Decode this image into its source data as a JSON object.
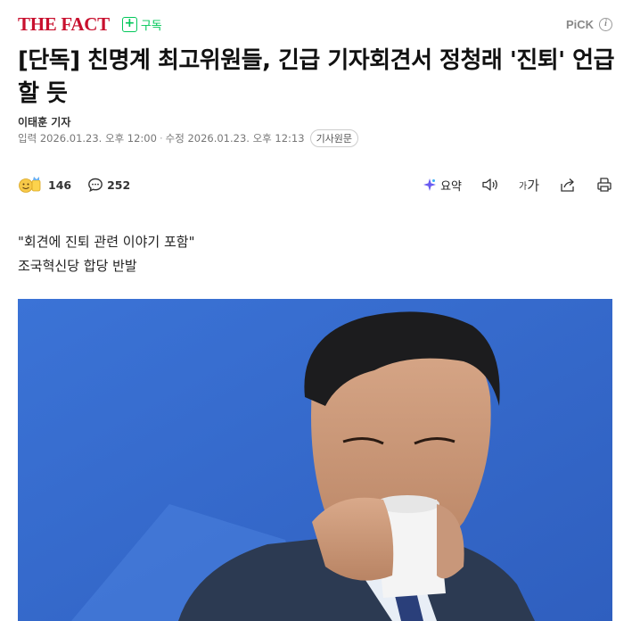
{
  "header": {
    "logo": "THE FACT",
    "subscribe_label": "구독",
    "pick_label": "PiCK",
    "info_icon": "ⓘ"
  },
  "article": {
    "headline": "[단독] 친명계 최고위원들, 긴급 기자회견서 정청래 '진퇴' 언급할 듯",
    "reporter": "이태훈 기자",
    "input_label": "입력",
    "input_date": "2026.01.23. 오후 12:00",
    "modified_label": "수정",
    "modified_date": "2026.01.23. 오후 12:13",
    "original_button": "기사원문",
    "subheads": [
      "\"회견에 진퇴 관련 이야기 포함\"",
      "조국혁신당 합당 반발"
    ]
  },
  "actions": {
    "reaction_count": "146",
    "comment_count": "252",
    "summary_label": "요약",
    "font_small": "가",
    "font_big": "가"
  },
  "colors": {
    "brand": "#c8102e",
    "subscribe": "#03c75a",
    "photo_bg": "#3a6fd0"
  }
}
